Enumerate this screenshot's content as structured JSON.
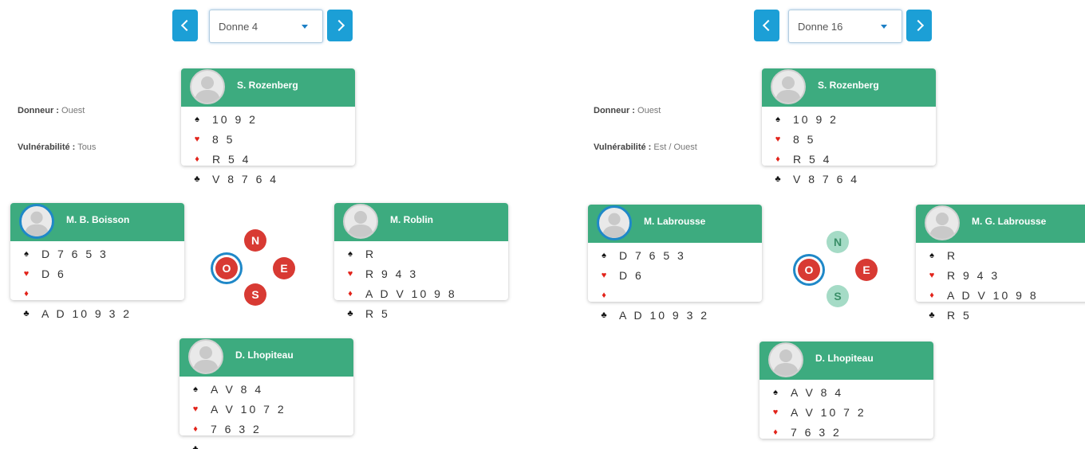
{
  "deals": [
    {
      "select_label": "Donne 4",
      "dealer_label": "Donneur :",
      "dealer_value": "Ouest",
      "vuln_label": "Vulnérabilité :",
      "vuln_value": "Tous",
      "compass": {
        "n": {
          "label": "N",
          "style": "red"
        },
        "e": {
          "label": "E",
          "style": "red"
        },
        "s": {
          "label": "S",
          "style": "red"
        },
        "o": {
          "label": "O",
          "style": "red",
          "current": true
        }
      },
      "players": {
        "north": {
          "name": "S. Rozenberg",
          "active": false,
          "hand": [
            {
              "suit": "spade-icon",
              "cards": "10 9 2"
            },
            {
              "suit": "heart-icon",
              "cards": "8 5"
            },
            {
              "suit": "diamond-icon",
              "cards": "R 5 4"
            },
            {
              "suit": "club-icon",
              "cards": "V 8 7 6 4"
            }
          ]
        },
        "west": {
          "name": "M. B. Boisson",
          "active": true,
          "hand": [
            {
              "suit": "spade-icon",
              "cards": "D 7 6 5 3"
            },
            {
              "suit": "heart-icon",
              "cards": "D 6"
            },
            {
              "suit": "diamond-icon",
              "cards": ""
            },
            {
              "suit": "club-icon",
              "cards": "A D 10 9 3 2"
            }
          ]
        },
        "east": {
          "name": "M. Roblin",
          "active": false,
          "hand": [
            {
              "suit": "spade-icon",
              "cards": "R"
            },
            {
              "suit": "heart-icon",
              "cards": "R 9 4 3"
            },
            {
              "suit": "diamond-icon",
              "cards": "A D V 10 9 8"
            },
            {
              "suit": "club-icon",
              "cards": "R 5"
            }
          ]
        },
        "south": {
          "name": "D. Lhopiteau",
          "active": false,
          "hand": [
            {
              "suit": "spade-icon",
              "cards": "A V 8 4"
            },
            {
              "suit": "heart-icon",
              "cards": "A V 10 7 2"
            },
            {
              "suit": "diamond-icon",
              "cards": "7 6 3 2"
            },
            {
              "suit": "club-icon",
              "cards": ""
            }
          ]
        }
      }
    },
    {
      "select_label": "Donne 16",
      "dealer_label": "Donneur :",
      "dealer_value": "Ouest",
      "vuln_label": "Vulnérabilité :",
      "vuln_value": "Est / Ouest",
      "compass": {
        "n": {
          "label": "N",
          "style": "mint"
        },
        "e": {
          "label": "E",
          "style": "red"
        },
        "s": {
          "label": "S",
          "style": "mint"
        },
        "o": {
          "label": "O",
          "style": "red",
          "current": true
        }
      },
      "players": {
        "north": {
          "name": "S. Rozenberg",
          "active": false,
          "hand": [
            {
              "suit": "spade-icon",
              "cards": "10 9 2"
            },
            {
              "suit": "heart-icon",
              "cards": "8 5"
            },
            {
              "suit": "diamond-icon",
              "cards": "R 5 4"
            },
            {
              "suit": "club-icon",
              "cards": "V 8 7 6 4"
            }
          ]
        },
        "west": {
          "name": "M. Labrousse",
          "active": true,
          "hand": [
            {
              "suit": "spade-icon",
              "cards": "D 7 6 5 3"
            },
            {
              "suit": "heart-icon",
              "cards": "D 6"
            },
            {
              "suit": "diamond-icon",
              "cards": ""
            },
            {
              "suit": "club-icon",
              "cards": "A D 10 9 3 2"
            }
          ]
        },
        "east": {
          "name": "M. G. Labrousse",
          "active": false,
          "hand": [
            {
              "suit": "spade-icon",
              "cards": "R"
            },
            {
              "suit": "heart-icon",
              "cards": "R 9 4 3"
            },
            {
              "suit": "diamond-icon",
              "cards": "A D V 10 9 8"
            },
            {
              "suit": "club-icon",
              "cards": "R 5"
            }
          ]
        },
        "south": {
          "name": "D. Lhopiteau",
          "active": false,
          "hand": [
            {
              "suit": "spade-icon",
              "cards": "A V 8 4"
            },
            {
              "suit": "heart-icon",
              "cards": "A V 10 7 2"
            },
            {
              "suit": "diamond-icon",
              "cards": "7 6 3 2"
            }
          ]
        }
      }
    }
  ]
}
